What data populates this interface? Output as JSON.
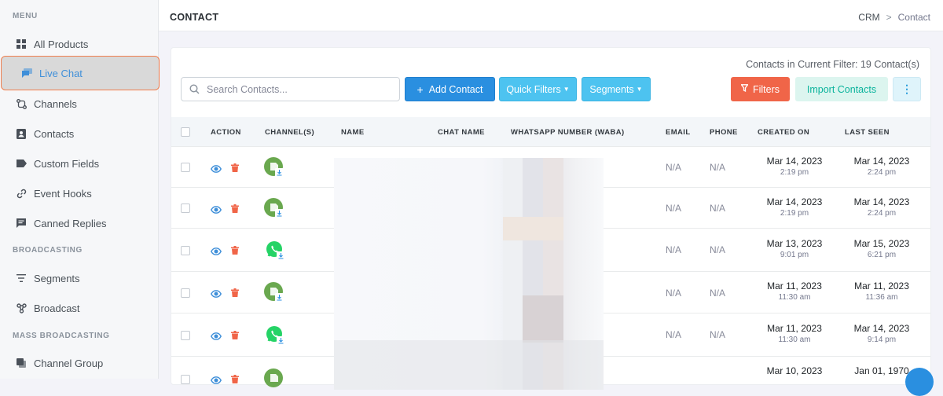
{
  "sidebar": {
    "section_menu": "MENU",
    "section_broadcasting": "BROADCASTING",
    "section_mass": "MASS BROADCASTING",
    "items": [
      {
        "label": "All Products",
        "icon": "grid-icon"
      },
      {
        "label": "Live Chat",
        "icon": "chat-icon"
      },
      {
        "label": "Channels",
        "icon": "channels-icon"
      },
      {
        "label": "Contacts",
        "icon": "contact-card-icon"
      },
      {
        "label": "Custom Fields",
        "icon": "tag-icon"
      },
      {
        "label": "Event Hooks",
        "icon": "link-icon"
      },
      {
        "label": "Canned Replies",
        "icon": "message-icon"
      },
      {
        "label": "Segments",
        "icon": "filter-lines-icon"
      },
      {
        "label": "Broadcast",
        "icon": "broadcast-icon"
      },
      {
        "label": "Channel Group",
        "icon": "channel-group-icon"
      }
    ]
  },
  "header": {
    "title": "CONTACT",
    "breadcrumb_root": "CRM",
    "breadcrumb_sep": ">",
    "breadcrumb_current": "Contact"
  },
  "toolbar": {
    "filter_count": "Contacts in Current Filter: 19 Contact(s)",
    "search_placeholder": "Search Contacts...",
    "add_contact": "Add Contact",
    "quick_filters": "Quick Filters",
    "segments": "Segments",
    "filters": "Filters",
    "import_contacts": "Import Contacts",
    "more": "⋮"
  },
  "table": {
    "headers": [
      "ACTION",
      "CHANNEL(S)",
      "NAME",
      "CHAT NAME",
      "WHATSAPP NUMBER (WABA)",
      "EMAIL",
      "PHONE",
      "CREATED ON",
      "LAST SEEN"
    ],
    "rows": [
      {
        "channel": "generic",
        "email": "N/A",
        "phone": "N/A",
        "created_date": "Mar 14, 2023",
        "created_time": "2:19 pm",
        "seen_date": "Mar 14, 2023",
        "seen_time": "2:24 pm"
      },
      {
        "channel": "generic",
        "email": "N/A",
        "phone": "N/A",
        "created_date": "Mar 14, 2023",
        "created_time": "2:19 pm",
        "seen_date": "Mar 14, 2023",
        "seen_time": "2:24 pm"
      },
      {
        "channel": "whatsapp",
        "email": "N/A",
        "phone": "N/A",
        "created_date": "Mar 13, 2023",
        "created_time": "9:01 pm",
        "seen_date": "Mar 15, 2023",
        "seen_time": "6:21 pm"
      },
      {
        "channel": "generic",
        "email": "N/A",
        "phone": "N/A",
        "created_date": "Mar 11, 2023",
        "created_time": "11:30 am",
        "seen_date": "Mar 11, 2023",
        "seen_time": "11:36 am"
      },
      {
        "channel": "whatsapp",
        "email": "N/A",
        "phone": "N/A",
        "created_date": "Mar 11, 2023",
        "created_time": "11:30 am",
        "seen_date": "Mar 14, 2023",
        "seen_time": "9:14 pm"
      },
      {
        "channel": "generic",
        "email": "",
        "phone": "",
        "created_date": "Mar 10, 2023",
        "created_time": "",
        "seen_date": "Jan 01, 1970",
        "seen_time": ""
      }
    ]
  },
  "colors": {
    "primary": "#2a8fe0",
    "info": "#4dc3f0",
    "danger": "#f06548",
    "success_soft": "#dcf5ef",
    "channel_green": "#6aa84f",
    "whatsapp": "#25d366",
    "active_outline": "#ef7d4d"
  }
}
